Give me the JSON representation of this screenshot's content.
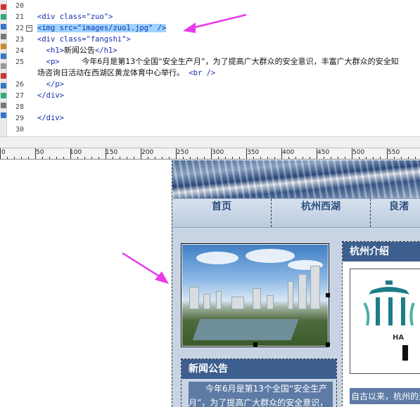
{
  "editor": {
    "lines": [
      {
        "num": "20",
        "code": ""
      },
      {
        "num": "21",
        "code": "<div class=\"zuo\">"
      },
      {
        "num": "22",
        "code": "<img src=\"images/zuo1.jpg\" />"
      },
      {
        "num": "23",
        "code": "<div class=\"fangshi\">"
      },
      {
        "num": "24",
        "code_pre": "  <h1>",
        "code_cn": "新闻公告",
        "code_post": "</h1>"
      },
      {
        "num": "25",
        "code_pre": "  <p>     ",
        "code_cn": "今年6月是第13个全国“安全生产月”，为了提高广大群众的安全意识，丰富广大群众的安全知",
        "code_post": ""
      },
      {
        "num": "",
        "cont_cn": "场咨询日活动在西湖区黄龙体育中心举行。",
        "cont_code": " <br />"
      },
      {
        "num": "26",
        "code": "  </p>"
      },
      {
        "num": "27",
        "code": "</div>"
      },
      {
        "num": "28",
        "code": ""
      },
      {
        "num": "29",
        "code": "</div>"
      },
      {
        "num": "30",
        "code": ""
      }
    ],
    "fold_marker": "−"
  },
  "ruler": {
    "labels": [
      "0",
      "50",
      "100",
      "150",
      "200",
      "250",
      "300",
      "350",
      "400",
      "450",
      "500",
      "550"
    ]
  },
  "site": {
    "nav": [
      "首页",
      "杭州西湖",
      "良渚"
    ],
    "news_title": "新闻公告",
    "news_text": "今年6月是第13个全国“安全生产月”，为了提高广大群众的安全意识，",
    "intro_title": "杭州介绍",
    "intro_logo_text": "HA",
    "intro_text": "自古以来，杭州的景"
  },
  "colors": {
    "selection": "#9ed4ff",
    "arrow": "#e83ce8",
    "panel_header": "#3d5f8f",
    "page_bg": "#c8d4e4"
  }
}
